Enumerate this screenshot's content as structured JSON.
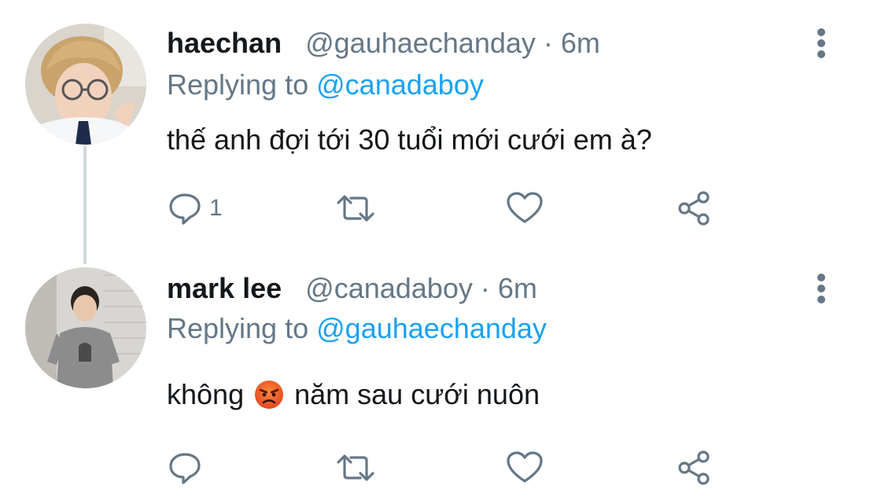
{
  "thread": [
    {
      "display_name": "haechan",
      "handle": "@gauhaechanday",
      "time": "6m",
      "replying_prefix": "Replying to",
      "replying_to": "@canadaboy",
      "text": "thế anh đợi tới 30 tuổi mới cưới em à?",
      "actions": {
        "reply_count": "1",
        "retweet_count": "",
        "like_count": ""
      }
    },
    {
      "display_name": "mark lee",
      "handle": "@canadaboy",
      "time": "6m",
      "replying_prefix": "Replying to",
      "replying_to": "@gauhaechanday",
      "text_before_emoji": "không",
      "emoji": "angry-face-emoji",
      "text_after_emoji": "năm sau cưới nuôn",
      "actions": {
        "reply_count": "",
        "retweet_count": "",
        "like_count": ""
      }
    }
  ],
  "colors": {
    "text_primary": "#14171a",
    "text_secondary": "#657786",
    "link": "#1da1f2",
    "thread_line": "#cfd9de",
    "icon": "#657786"
  },
  "icons": {
    "reply": "speech-bubble-icon",
    "retweet": "retweet-arrows-icon",
    "like": "heart-icon",
    "share": "share-nodes-icon",
    "more": "vertical-ellipsis-icon"
  }
}
